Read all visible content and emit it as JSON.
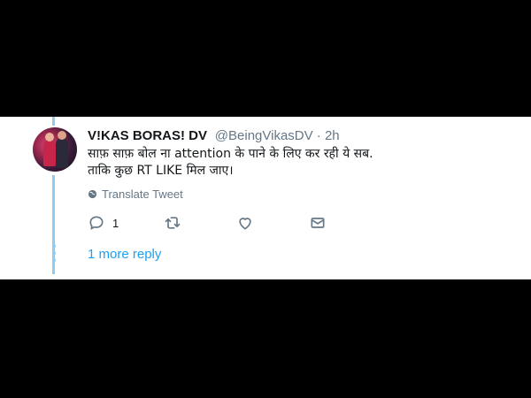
{
  "tweet": {
    "display_name": "V!KAS BORAS! DV",
    "handle_time": "@BeingVikasDV · 2h",
    "line1": "साफ़ साफ़ बोल ना attention के पाने के लिए कर रही ये सब.",
    "line2": "ताकि कुछ RT LIKE  मिल जाए।",
    "translate_label": "Translate Tweet",
    "reply_count": "1",
    "more_replies": "1 more reply"
  },
  "icons": {
    "avatar": "avatar",
    "translate": "globe-icon",
    "reply": "reply-icon",
    "retweet": "retweet-icon",
    "like": "heart-icon",
    "dm": "envelope-icon"
  },
  "colors": {
    "thread_line": "#8ecdf0",
    "link": "#1da1f2",
    "secondary_text": "#657786",
    "icon": "#657786"
  }
}
